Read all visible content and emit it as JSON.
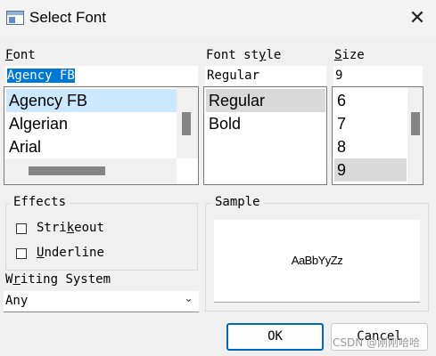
{
  "window": {
    "title": "Select Font",
    "close_glyph": "✕"
  },
  "font": {
    "label_accel": "F",
    "label_rest": "ont",
    "value": "Agency FB",
    "items": [
      "Agency FB",
      "Algerian",
      "Arial"
    ],
    "selected_index": 0
  },
  "style": {
    "label_pre": "Font st",
    "label_accel": "y",
    "label_post": "le",
    "value": "Regular",
    "items": [
      "Regular",
      "Bold"
    ],
    "selected_index": 0
  },
  "size": {
    "label_accel": "S",
    "label_rest": "ize",
    "value": "9",
    "items": [
      "6",
      "7",
      "8",
      "9"
    ],
    "selected_index": 3
  },
  "effects": {
    "title": "Effects",
    "strikeout_pre": "Stri",
    "strikeout_accel": "k",
    "strikeout_post": "eout",
    "strikeout_checked": false,
    "underline_accel": "U",
    "underline_rest": "nderline",
    "underline_checked": false
  },
  "writing_system": {
    "label_pre": "W",
    "label_accel": "r",
    "label_post": "iting System",
    "value": "Any",
    "chevron_glyph": "⌄"
  },
  "sample": {
    "title": "Sample",
    "text": "AaBbYyZz"
  },
  "buttons": {
    "ok": "OK",
    "cancel": "Cancel"
  },
  "watermark": "CSDN @刚刚哈哈"
}
